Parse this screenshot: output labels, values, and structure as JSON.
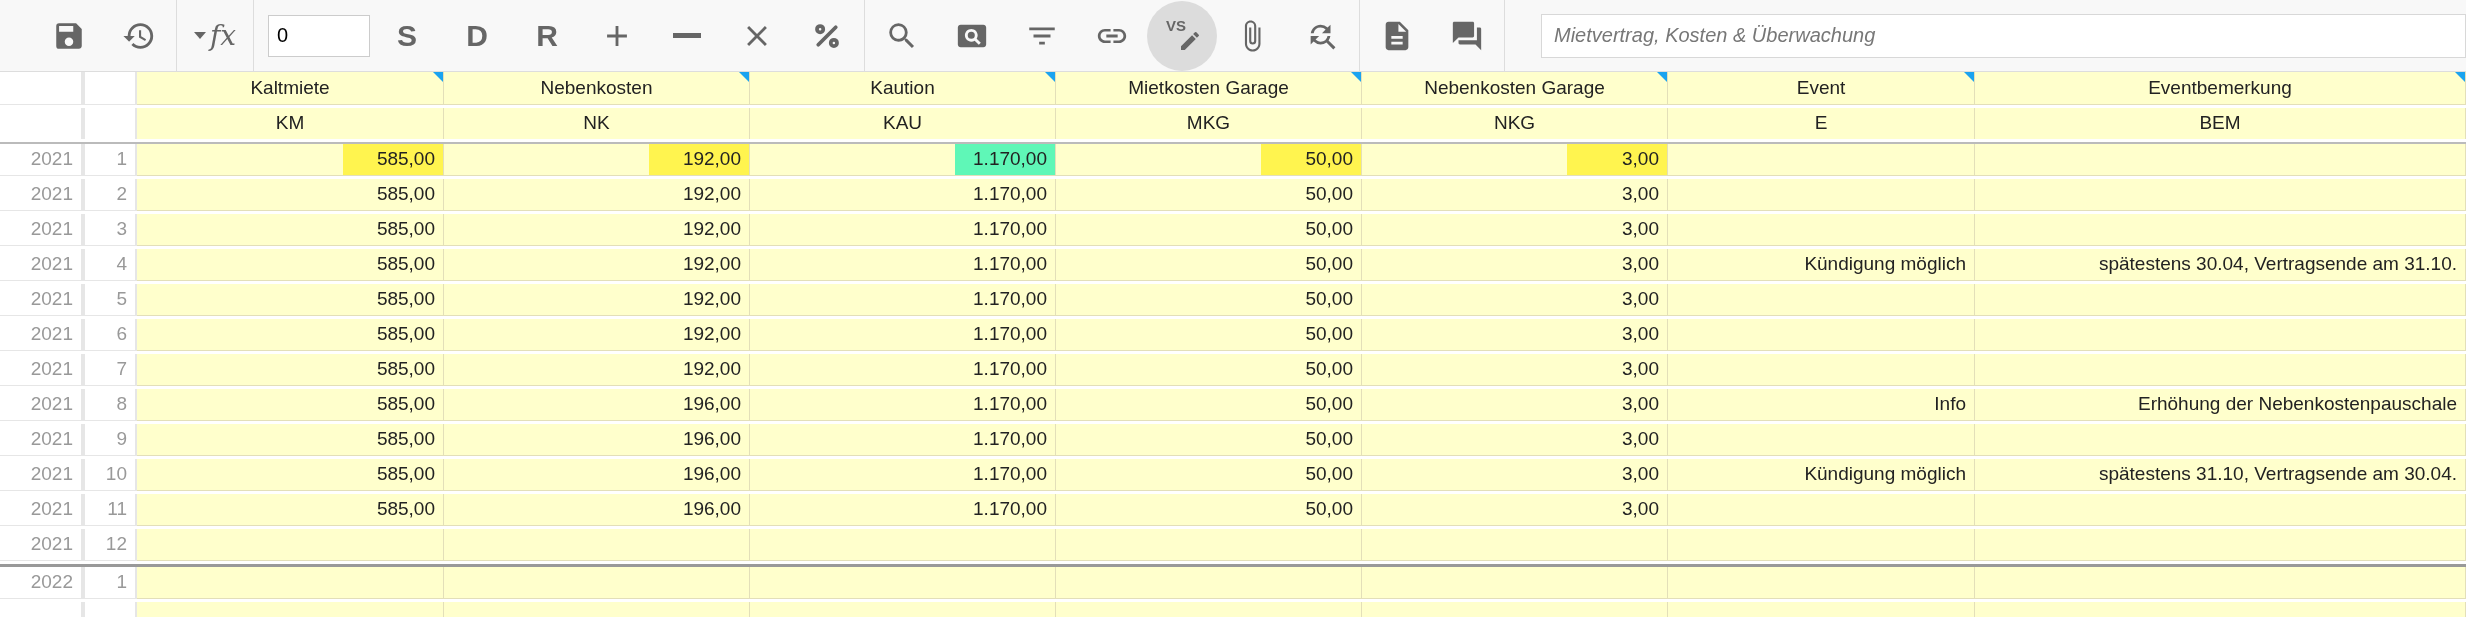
{
  "toolbar": {
    "items": [
      {
        "kind": "icon"
      },
      {
        "kind": "icon"
      },
      {
        "kind": "divider"
      },
      {
        "kind": "formula",
        "text": "fx"
      },
      {
        "kind": "divider"
      },
      {
        "kind": "input",
        "value": "0"
      },
      {
        "kind": "letter",
        "text": "S"
      },
      {
        "kind": "letter",
        "text": "D"
      },
      {
        "kind": "letter",
        "text": "R"
      },
      {
        "kind": "icon"
      },
      {
        "kind": "icon"
      },
      {
        "kind": "icon"
      },
      {
        "kind": "icon"
      },
      {
        "kind": "divider"
      },
      {
        "kind": "icon"
      },
      {
        "kind": "icon"
      },
      {
        "kind": "icon"
      },
      {
        "kind": "icon"
      },
      {
        "kind": "vs",
        "text": "VS",
        "selected": true
      },
      {
        "kind": "icon"
      },
      {
        "kind": "icon"
      },
      {
        "kind": "divider"
      },
      {
        "kind": "icon"
      },
      {
        "kind": "icon"
      },
      {
        "kind": "divider"
      }
    ],
    "search": {
      "placeholder": "Mietvertrag, Kosten & Überwachung"
    }
  },
  "columns": [
    {
      "name": "Kaltmiete",
      "code": "KM",
      "flagged": true
    },
    {
      "name": "Nebenkosten",
      "code": "NK",
      "flagged": true
    },
    {
      "name": "Kaution",
      "code": "KAU",
      "flagged": true
    },
    {
      "name": "Mietkosten Garage",
      "code": "MKG",
      "flagged": true
    },
    {
      "name": "Nebenkosten Garage",
      "code": "NKG",
      "flagged": true
    },
    {
      "name": "Event",
      "code": "E",
      "flagged": true
    },
    {
      "name": "Eventbemerkung",
      "code": "BEM",
      "flagged": true
    }
  ],
  "rows": [
    {
      "year": "2021",
      "month": "1",
      "cells": [
        {
          "text": "585,00",
          "color": "#fff44f"
        },
        {
          "text": "192,00",
          "color": "#fff44f"
        },
        {
          "text": "1.170,00",
          "color": "#5ff7b7"
        },
        {
          "text": "50,00",
          "color": "#fff44f"
        },
        {
          "text": "3,00",
          "color": "#fff44f"
        },
        null,
        null
      ]
    },
    {
      "year": "2021",
      "month": "2",
      "cells": [
        "585,00",
        "192,00",
        "1.170,00",
        "50,00",
        "3,00",
        null,
        null
      ]
    },
    {
      "year": "2021",
      "month": "3",
      "cells": [
        "585,00",
        "192,00",
        "1.170,00",
        "50,00",
        "3,00",
        null,
        null
      ]
    },
    {
      "year": "2021",
      "month": "4",
      "cells": [
        "585,00",
        "192,00",
        "1.170,00",
        "50,00",
        "3,00",
        "Kündigung möglich",
        "spätestens 30.04, Vertragsende am 31.10."
      ]
    },
    {
      "year": "2021",
      "month": "5",
      "cells": [
        "585,00",
        "192,00",
        "1.170,00",
        "50,00",
        "3,00",
        null,
        null
      ]
    },
    {
      "year": "2021",
      "month": "6",
      "cells": [
        "585,00",
        "192,00",
        "1.170,00",
        "50,00",
        "3,00",
        null,
        null
      ]
    },
    {
      "year": "2021",
      "month": "7",
      "cells": [
        "585,00",
        "192,00",
        "1.170,00",
        "50,00",
        "3,00",
        null,
        null
      ]
    },
    {
      "year": "2021",
      "month": "8",
      "cells": [
        "585,00",
        "196,00",
        "1.170,00",
        "50,00",
        "3,00",
        "Info",
        "Erhöhung der Nebenkostenpauschale"
      ]
    },
    {
      "year": "2021",
      "month": "9",
      "cells": [
        "585,00",
        "196,00",
        "1.170,00",
        "50,00",
        "3,00",
        null,
        null
      ]
    },
    {
      "year": "2021",
      "month": "10",
      "cells": [
        "585,00",
        "196,00",
        "1.170,00",
        "50,00",
        "3,00",
        "Kündigung möglich",
        "spätestens 31.10, Vertragsende am 30.04."
      ]
    },
    {
      "year": "2021",
      "month": "11",
      "cells": [
        "585,00",
        "196,00",
        "1.170,00",
        "50,00",
        "3,00",
        null,
        null
      ]
    },
    {
      "year": "2021",
      "month": "12",
      "cells": [
        null,
        null,
        null,
        null,
        null,
        null,
        null
      ],
      "year_end": true
    },
    {
      "year": "2022",
      "month": "1",
      "cells": [
        null,
        null,
        null,
        null,
        null,
        null,
        null
      ]
    },
    {
      "cells": [
        null,
        null,
        null,
        null,
        null,
        null,
        null
      ]
    }
  ]
}
